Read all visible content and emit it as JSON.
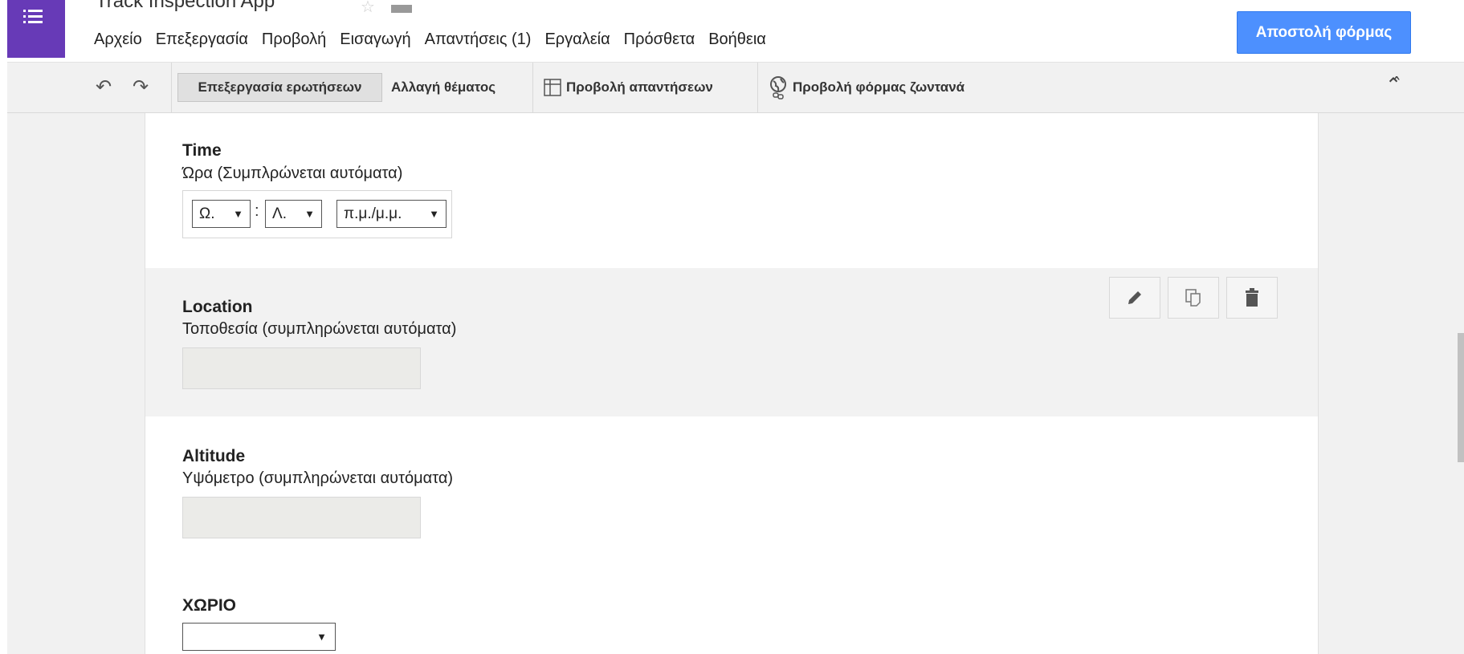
{
  "app": {
    "title": "Track Inspection App",
    "menu": [
      "Αρχείο",
      "Επεξεργασία",
      "Προβολή",
      "Εισαγωγή",
      "Απαντήσεις (1)",
      "Εργαλεία",
      "Πρόσθετα",
      "Βοήθεια"
    ],
    "send_label": "Αποστολή φόρμας"
  },
  "toolbar": {
    "edit_questions": "Επεξεργασία ερωτήσεων",
    "change_theme": "Αλλαγή θέματος",
    "view_responses": "Προβολή απαντήσεων",
    "view_live_form": "Προβολή φόρμας ζωντανά"
  },
  "questions": {
    "time": {
      "title": "Time",
      "help": "Ώρα (Συμπλρώνεται αυτόματα)",
      "hour": "Ω.",
      "minute": "Λ.",
      "ampm": "π.μ./μ.μ."
    },
    "location": {
      "title": "Location",
      "help": "Τοποθεσία (συμπληρώνεται αυτόματα)"
    },
    "altitude": {
      "title": "Altitude",
      "help": "Υψόμετρο (συμπληρώνεται αυτόματα)"
    },
    "xorio": {
      "title": "ΧΩΡΙΟ",
      "selected": ""
    }
  },
  "icons": {
    "app": "forms-list-icon",
    "star": "star-icon",
    "folder": "folder-icon",
    "undo": "undo-icon",
    "redo": "redo-icon",
    "table": "table-icon",
    "globe_link": "globe-link-icon",
    "collapse": "double-chevron-up-icon",
    "edit": "pencil-icon",
    "duplicate": "duplicate-icon",
    "delete": "trash-icon"
  },
  "colors": {
    "brand": "#673ab7",
    "send_button": "#4d90fe"
  }
}
